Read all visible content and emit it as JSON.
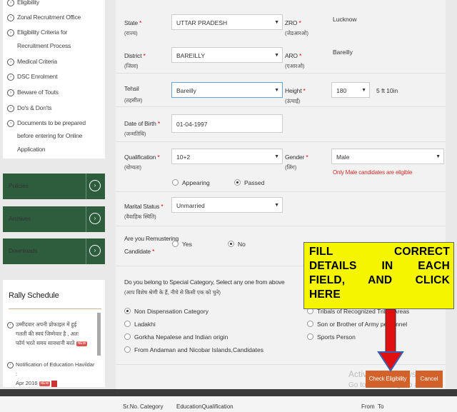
{
  "sidebar": {
    "menu_items": [
      {
        "icon": "chevron-right-icon",
        "label": "Eligibility"
      },
      {
        "icon": "chevron-right-icon",
        "label": "Zonal Recruitment Office"
      },
      {
        "icon": "chevron-right-icon",
        "label": "Eligibility Criteria for"
      },
      {
        "icon": "",
        "label": "Recruitment Process"
      },
      {
        "icon": "chevron-right-icon",
        "label": "Medical Criteria"
      },
      {
        "icon": "chevron-right-icon",
        "label": "DSC Enrolment"
      },
      {
        "icon": "chevron-right-icon",
        "label": "Beware of Touts"
      },
      {
        "icon": "chevron-right-icon",
        "label": "Do's & Don'ts"
      },
      {
        "icon": "chevron-right-icon",
        "label": "Documents to be prepared"
      },
      {
        "icon": "",
        "label": "before entering for Online"
      },
      {
        "icon": "",
        "label": "Application"
      }
    ],
    "buttons": [
      {
        "label": "Policies"
      },
      {
        "label": "Archives"
      },
      {
        "label": "Downloads"
      }
    ],
    "rally": {
      "title": "Rally Schedule",
      "items": [
        {
          "lines": [
            "उम्मीदवार अपनी प्रोफाइल में हुई",
            "गलती की स्वयं जिम्मेवार है , अतः",
            "फॉर्म भरते समय सावधानी बरते"
          ],
          "badge": "NEW"
        },
        {
          "lines": [
            "Notification of Education Havildar :",
            "Apr 2016"
          ],
          "badge": "NEW"
        }
      ]
    }
  },
  "form": {
    "state": {
      "label": "State",
      "hindi": "(राज्य)",
      "value": "UTTAR PRADESH"
    },
    "zro": {
      "label": "ZRO",
      "hindi": "(जेडआरओ)",
      "value": "Lucknow"
    },
    "district": {
      "label": "District",
      "hindi": "(जिला)",
      "value": "BAREILLY"
    },
    "aro": {
      "label": "ARO",
      "hindi": "(एआरओ)",
      "value": "Bareilly"
    },
    "tehsil": {
      "label": "Tehsil",
      "hindi": "(तहसील)",
      "value": "Bareilly"
    },
    "height": {
      "label": "Height",
      "hindi": "(ऊंचाई)",
      "value": "180",
      "converted": "5 ft 10in"
    },
    "dob": {
      "label": "Date of Birth",
      "hindi": "(जन्मतिथि)",
      "value": "01-04-1997"
    },
    "qualification": {
      "label": "Qualification",
      "hindi": "(योग्यता)",
      "value": "10+2",
      "options": [
        "Appearing",
        "Passed"
      ],
      "selected": "Passed"
    },
    "gender": {
      "label": "Gender",
      "hindi": "(लिंग)",
      "value": "Male",
      "hint": "Only Male candidates are eligible"
    },
    "marital": {
      "label": "Marital Status",
      "hindi": "(वैवाहिक स्थिति)",
      "value": "Unmarried"
    },
    "remustering": {
      "label_line1": "Are you Remustering",
      "label_line2": "Candidate",
      "options": [
        "Yes",
        "No"
      ],
      "selected": "No"
    },
    "special": {
      "question": "Do you belong to Special Category, Select any one from above",
      "question_hindi": "(आप विशेष श्रेणी के हैं, नीचे से किसी एक को चुने)",
      "left_options": [
        "Non Dispensation Category",
        "Ladakhi",
        "Gorkha Nepalese and Indian origin",
        "From Andaman and Nicobar Islands,Candidates"
      ],
      "right_options": [
        "Tribals of Recognized Tribal Areas",
        "Son or Brother of Army personnel",
        "Sports Person"
      ],
      "selected": "Non Dispensation Category"
    },
    "check_eligibility": "Check Eligibility",
    "cancel": "Cancel"
  },
  "callout": {
    "lines": [
      "FILL CORRECT",
      "DETAILS IN EACH",
      "FIELD, AND CLICK",
      "HERE"
    ]
  },
  "watermark": {
    "line1": "Activate Windows",
    "line2": "Go to PC settings to activate Windows."
  },
  "table_header": {
    "sr": "Sr.No.",
    "category": "Category",
    "education": "EducationQualification",
    "from": "From",
    "to": "To"
  },
  "colors": {
    "sidebar_green": "#2e5d3d",
    "button_orange": "#d3622a",
    "callout_yellow": "#f5f500",
    "arrow_red": "#e01010",
    "required_red": "#dd0000"
  }
}
